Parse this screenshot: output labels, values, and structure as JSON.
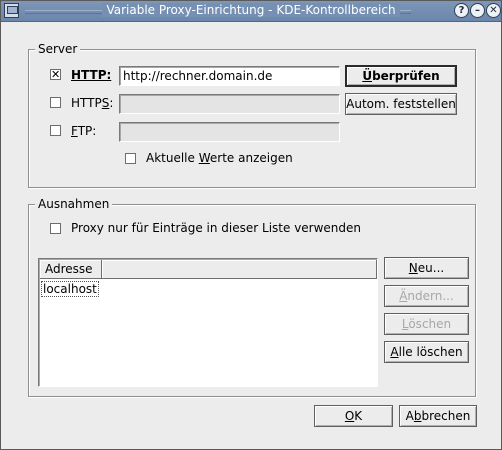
{
  "window": {
    "title": "Variable Proxy-Einrichtung - KDE-Kontrollbereich"
  },
  "titlebar_buttons": [
    {
      "icon": "help-icon",
      "glyph": "?"
    },
    {
      "icon": "minimize-icon",
      "glyph": "–"
    },
    {
      "icon": "close-icon",
      "glyph": "✕"
    }
  ],
  "server": {
    "group_label": "Server",
    "http": {
      "label": "HTTP:",
      "checked": true,
      "check_glyph": "✕",
      "value": "http://rechner.domain.de"
    },
    "https": {
      "label_pre": "HTTP",
      "label_u": "S",
      "label_post": ":",
      "checked": false,
      "value": ""
    },
    "ftp": {
      "label_u": "F",
      "label_post": "TP:",
      "checked": false,
      "value": ""
    },
    "show_values": {
      "label_pre": "Aktuelle ",
      "label_u": "W",
      "label_post": "erte anzeigen",
      "checked": false
    },
    "verify_button": {
      "label_u": "Ü",
      "label_post": "berprüfen"
    },
    "autodetect_button": {
      "label": "Autom. feststellen"
    }
  },
  "exceptions": {
    "group_label": "Ausnahmen",
    "only_list": {
      "label": "Proxy nur für Einträge in dieser Liste verwenden",
      "checked": false
    },
    "list": {
      "column_header": "Adresse",
      "rows": [
        "localhost"
      ]
    },
    "new_button": {
      "label_u": "N",
      "label_post": "eu..."
    },
    "change_button": {
      "label_u": "Ä",
      "label_post": "ndern...",
      "enabled": false
    },
    "delete_button": {
      "label_u": "L",
      "label_post": "öschen",
      "enabled": false
    },
    "delete_all_button": {
      "label_u": "A",
      "label_post": "lle löschen"
    }
  },
  "footer": {
    "ok_button": {
      "label_u": "O",
      "label_post": "K"
    },
    "cancel_button": {
      "label_pre": "A",
      "label_u": "b",
      "label_post": "brechen"
    }
  },
  "colors": {
    "titlebar": "#7590b3",
    "background": "#ececec",
    "disabled_text": "#a7a7a7"
  }
}
